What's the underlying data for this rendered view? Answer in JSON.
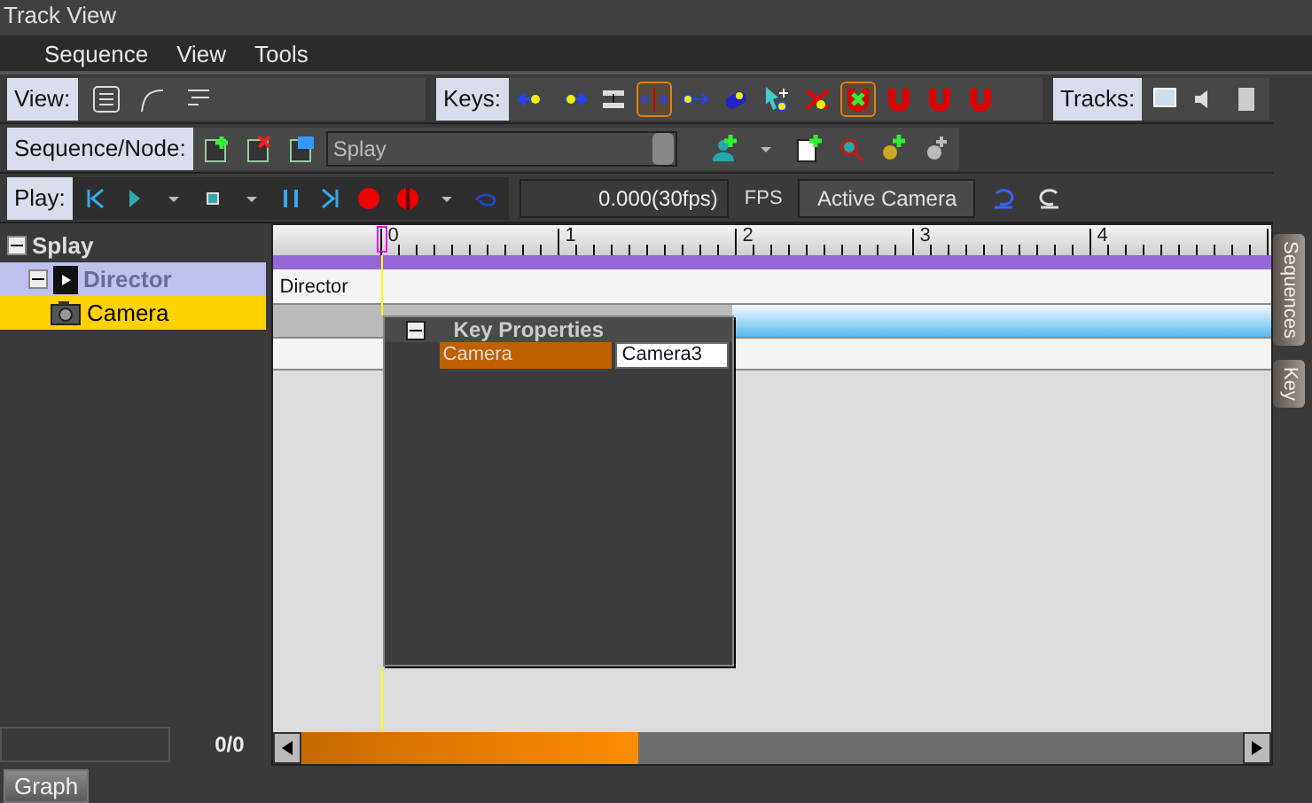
{
  "window": {
    "title": "Track View"
  },
  "menu": [
    "Sequence",
    "View",
    "Tools"
  ],
  "view_bar": {
    "label": "View:"
  },
  "keys_bar": {
    "label": "Keys:",
    "buttons": [
      {
        "selected": false
      },
      {
        "selected": false
      },
      {
        "selected": false
      },
      {
        "selected": true
      },
      {
        "selected": false
      },
      {
        "selected": false
      },
      {
        "selected": false
      },
      {
        "selected": false
      },
      {
        "selected": true
      },
      {
        "selected": false
      },
      {
        "selected": false
      },
      {
        "selected": false
      }
    ]
  },
  "tracks_bar": {
    "label": "Tracks:"
  },
  "sequence_bar": {
    "label": "Sequence/Node:",
    "sequence": "Splay"
  },
  "play_bar": {
    "label": "Play:",
    "time": "0.000(30fps)",
    "fps": "FPS",
    "camera_button": "Active Camera"
  },
  "side_tabs": [
    "Sequences",
    "Key"
  ],
  "tree": {
    "label": "Splay",
    "expanded": true,
    "children": [
      {
        "label": "Director",
        "kind": "director",
        "expanded": true,
        "disabled": true,
        "selected": false,
        "children": [
          {
            "label": "Camera",
            "kind": "camera",
            "selected": true
          }
        ]
      }
    ]
  },
  "counter": "0/0",
  "timeline": {
    "ruler": [
      "0",
      "1",
      "2",
      "3",
      "4"
    ],
    "tracks": [
      {
        "label": "Director",
        "kind": "text"
      },
      {
        "kind": "keys"
      }
    ]
  },
  "key_properties": {
    "title": "Key Properties",
    "expanded": true,
    "rows": [
      {
        "name": "Camera",
        "value": "Camera3"
      }
    ]
  },
  "bottom_tab": "Graph"
}
